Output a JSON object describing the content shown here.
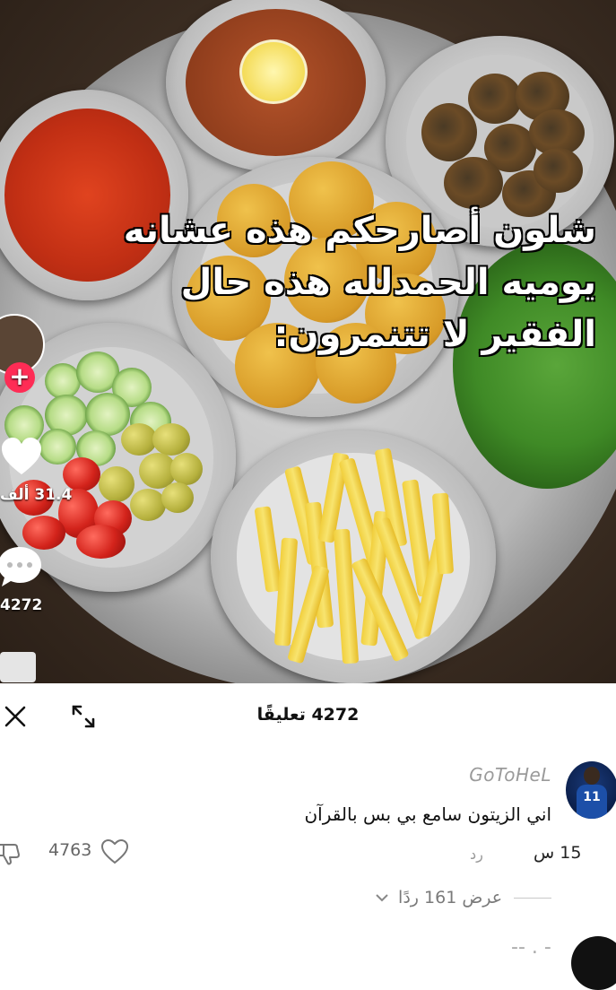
{
  "video": {
    "caption_lines": [
      "شلون أصارحكم هذه عشانه",
      "يوميه الحمدلله هذه حال",
      "الفقير لا تتنمرون:"
    ],
    "side": {
      "like_count": "31.4 ألف",
      "comment_count": "4272"
    },
    "icons": [
      "follow-plus-icon",
      "heart-icon",
      "comment-bubble-icon"
    ]
  },
  "comments_panel": {
    "title": "4272 تعليقًا",
    "icons": [
      "close-icon",
      "expand-icon"
    ],
    "comment": {
      "username": "GoToHeL",
      "text": "اني الزيتون سامع بي بس بالقرآن",
      "time": "15 س",
      "reply_label": "رد",
      "likes": "4763",
      "view_replies": "عرض 161 ردًا",
      "icons": [
        "heart-outline-icon",
        "dislike-icon",
        "chevron-down-icon"
      ]
    },
    "bottom_hint": "-- . -"
  },
  "colors": {
    "accent": "#fe2c55",
    "panel_bg": "#ffffff",
    "muted_text": "#9a9a9a"
  }
}
